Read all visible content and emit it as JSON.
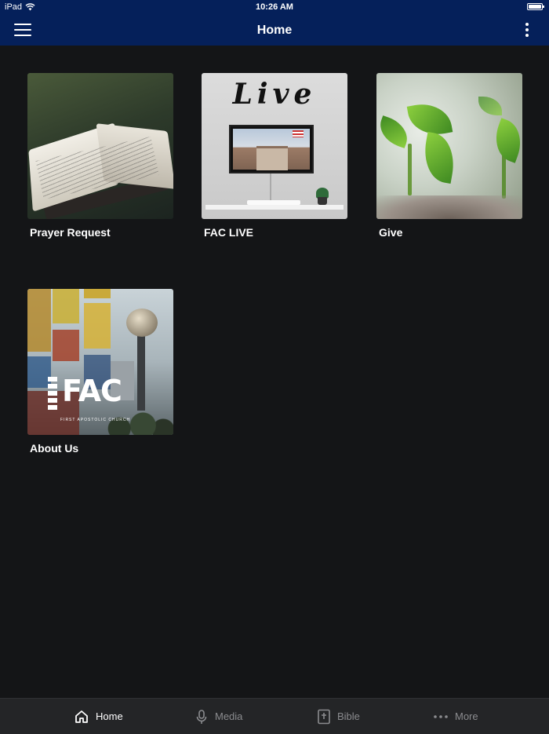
{
  "status_bar": {
    "device": "iPad",
    "time": "10:26 AM"
  },
  "header": {
    "title": "Home"
  },
  "tiles": [
    {
      "label": "Prayer Request",
      "image": "open-bible"
    },
    {
      "label": "FAC LIVE",
      "image": "live-tv",
      "image_text": "Live"
    },
    {
      "label": "Give",
      "image": "seedlings"
    },
    {
      "label": "About Us",
      "image": "fac-logo-city",
      "image_text": "FAC",
      "image_subtext": "FIRST APOSTOLIC CHURCH"
    }
  ],
  "tabbar": {
    "items": [
      {
        "label": "Home",
        "icon": "home-icon",
        "active": true
      },
      {
        "label": "Media",
        "icon": "microphone-icon",
        "active": false
      },
      {
        "label": "Bible",
        "icon": "bible-icon",
        "active": false
      },
      {
        "label": "More",
        "icon": "ellipsis-icon",
        "active": false
      }
    ]
  },
  "colors": {
    "header_bg": "#05205a",
    "page_bg": "#141517",
    "tabbar_bg": "#242527",
    "tab_inactive": "#8b8c8f",
    "tab_active": "#ffffff"
  }
}
